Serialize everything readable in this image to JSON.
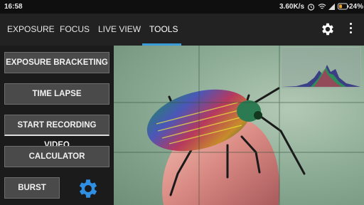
{
  "status_bar": {
    "time": "16:58",
    "speed": "3.60K/s",
    "battery": "24%",
    "icons": [
      "alarm-icon",
      "wifi-icon",
      "signal-icon",
      "battery-icon"
    ]
  },
  "tabs": [
    {
      "label": "EXPOSURE",
      "active": false
    },
    {
      "label": "FOCUS",
      "active": false
    },
    {
      "label": "LIVE VIEW",
      "active": false
    },
    {
      "label": "TOOLS",
      "active": true
    }
  ],
  "toolbar": {
    "settings_icon": "gear-icon",
    "overflow_icon": "more-vert-icon"
  },
  "tools_menu": {
    "buttons": [
      {
        "label": "EXPOSURE BRACKETING"
      },
      {
        "label": "TIME LAPSE"
      },
      {
        "label": "START RECORDING VIDEO"
      },
      {
        "label": "CALCULATOR"
      },
      {
        "label": "BURST"
      }
    ],
    "settings_icon": "gear-icon"
  },
  "colors": {
    "accent": "#3b9bd9",
    "button_bg": "#4a4a4a",
    "gear_blue": "#2f8fe3"
  }
}
